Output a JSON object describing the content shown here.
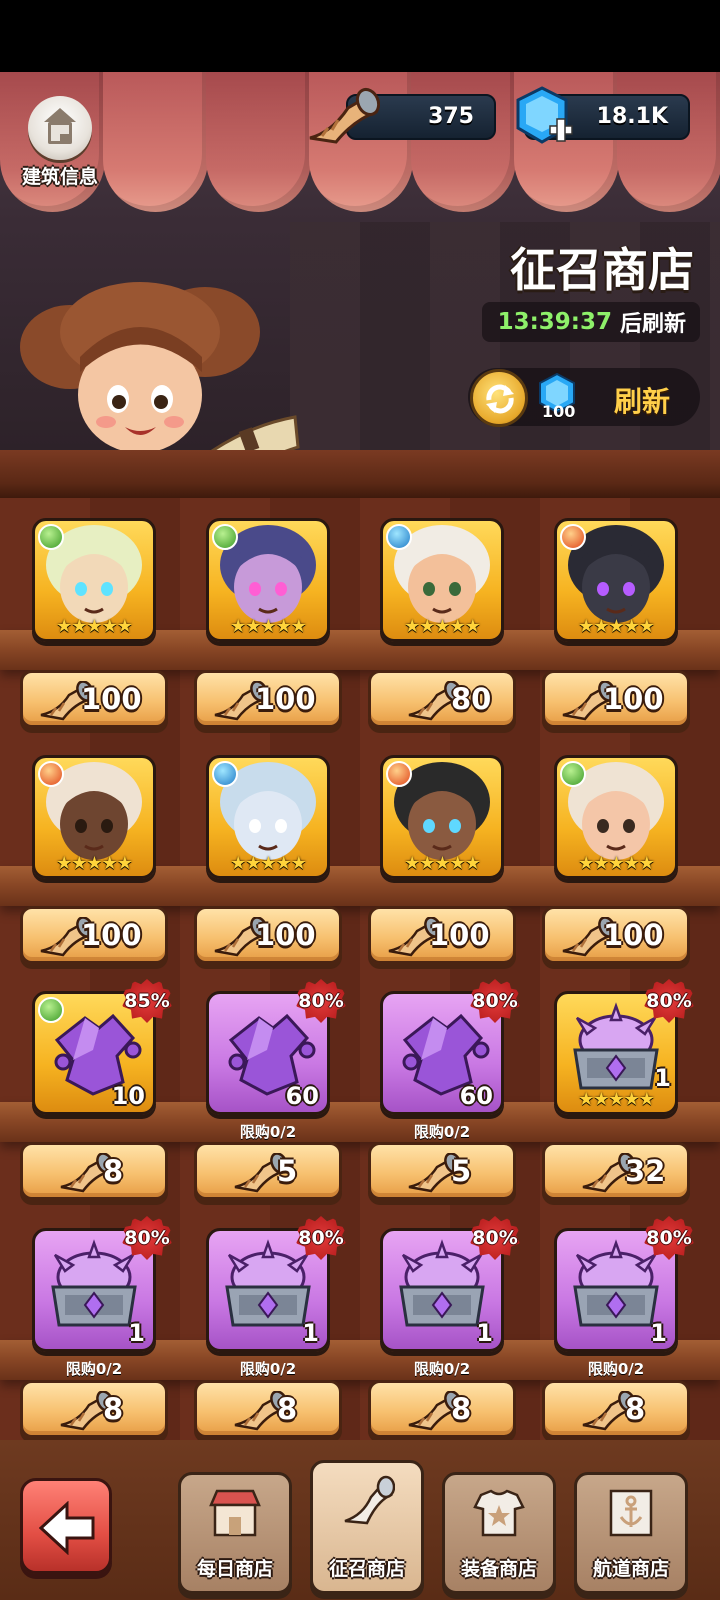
{
  "header": {
    "building_info_label": "建筑信息",
    "horn_count": "375",
    "gem_count": "18.1K",
    "shop_title": "征召商店",
    "timer": "13:39:37",
    "timer_suffix": "后刷新",
    "refresh_cost": "100",
    "refresh_label": "刷新"
  },
  "rows": [
    {
      "items": [
        {
          "kind": "hero",
          "element": "leaf",
          "stars": "★★★★★",
          "price": "100",
          "skin": "#f2d9b8",
          "hair": "#e7efc2",
          "eyes": "#5fe3ff"
        },
        {
          "kind": "hero",
          "element": "leaf",
          "stars": "★★★★★",
          "price": "100",
          "skin": "#c79ad9",
          "hair": "#4a4a8a",
          "eyes": "#ff5ed4"
        },
        {
          "kind": "hero",
          "element": "water",
          "stars": "★★★★★",
          "price": "80",
          "skin": "#f3c09a",
          "hair": "#f1ece4",
          "eyes": "#3a6a3a"
        },
        {
          "kind": "hero",
          "element": "fire",
          "stars": "★★★★★",
          "price": "100",
          "skin": "#3a3a46",
          "hair": "#2a2a34",
          "eyes": "#b65cff"
        }
      ]
    },
    {
      "items": [
        {
          "kind": "hero",
          "element": "fire",
          "stars": "★★★★★",
          "price": "100",
          "skin": "#6e4530",
          "hair": "#efe2d2",
          "eyes": "#2a1a10"
        },
        {
          "kind": "hero",
          "element": "water",
          "stars": "★★★★★",
          "price": "100",
          "skin": "#dfe8f4",
          "hair": "#c8dcec",
          "eyes": "#ffffff"
        },
        {
          "kind": "hero",
          "element": "fire",
          "stars": "★★★★★",
          "price": "100",
          "skin": "#8a5a40",
          "hair": "#2a2a2a",
          "eyes": "#5fd8ff"
        },
        {
          "kind": "hero",
          "element": "leaf",
          "stars": "★★★★★",
          "price": "100",
          "skin": "#f4c6a8",
          "hair": "#efe3d3",
          "eyes": "#3a2a20"
        }
      ]
    },
    {
      "items": [
        {
          "kind": "shard",
          "bg": "gold",
          "element": "leaf",
          "discount": "85%",
          "qty": "10",
          "price": "8",
          "limit": ""
        },
        {
          "kind": "shard",
          "bg": "purple",
          "element": "",
          "discount": "80%",
          "qty": "60",
          "price": "5",
          "limit": "限购0/2"
        },
        {
          "kind": "shard",
          "bg": "purple",
          "element": "",
          "discount": "80%",
          "qty": "60",
          "price": "5",
          "limit": "限购0/2"
        },
        {
          "kind": "chest",
          "bg": "gold",
          "element": "",
          "discount": "80%",
          "qty": "1",
          "stars": "★★★★★",
          "price": "32",
          "limit": ""
        }
      ]
    },
    {
      "items": [
        {
          "kind": "chest",
          "bg": "purple",
          "discount": "80%",
          "qty": "1",
          "price": "8",
          "limit": "限购0/2"
        },
        {
          "kind": "chest",
          "bg": "purple",
          "discount": "80%",
          "qty": "1",
          "price": "8",
          "limit": "限购0/2"
        },
        {
          "kind": "chest",
          "bg": "purple",
          "discount": "80%",
          "qty": "1",
          "price": "8",
          "limit": "限购0/2"
        },
        {
          "kind": "chest",
          "bg": "purple",
          "discount": "80%",
          "qty": "1",
          "price": "8",
          "limit": "限购0/2"
        }
      ]
    }
  ],
  "tabs": [
    {
      "label": "每日商店",
      "active": false,
      "icon": "shop-stall-icon"
    },
    {
      "label": "征召商店",
      "active": true,
      "icon": "horn-icon"
    },
    {
      "label": "装备商店",
      "active": false,
      "icon": "armor-icon"
    },
    {
      "label": "航道商店",
      "active": false,
      "icon": "anchor-banner-icon"
    }
  ],
  "colors": {
    "accent_gold": "#ffcf4a",
    "timer_green": "#8ef06a",
    "discount_red": "#d42a2a"
  }
}
